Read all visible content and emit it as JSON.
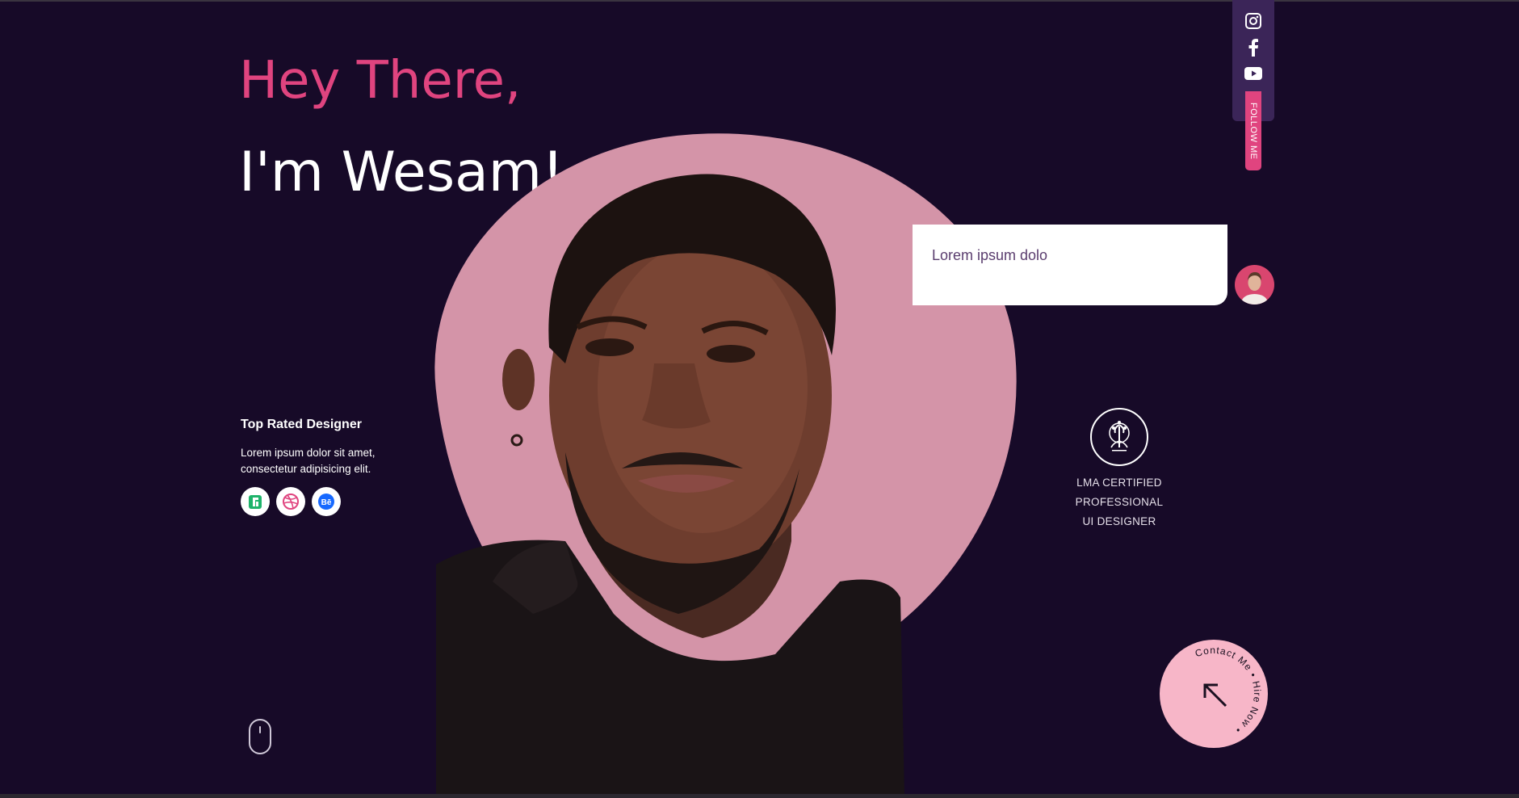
{
  "hero": {
    "greeting": "Hey There,",
    "name": "I'm Wesam!"
  },
  "chat": {
    "message": "Lorem ipsum dolo"
  },
  "social": {
    "icons": [
      "instagram-icon",
      "facebook-icon",
      "youtube-icon"
    ],
    "follow_label": "FOLLOW ME"
  },
  "rated": {
    "title": "Top Rated Designer",
    "description": "Lorem ipsum dolor sit amet, consectetur adipisicing elit.",
    "badges": [
      "upwork-icon",
      "dribbble-icon",
      "behance-icon"
    ]
  },
  "certification": {
    "line1": "LMA CERTIFIED",
    "line2": "PROFESSIONAL",
    "line3": "UI DESIGNER"
  },
  "contact": {
    "circular_text": "Contact Me • Hire Now •"
  },
  "colors": {
    "background": "#170a28",
    "accent_pink": "#e0447f",
    "blob_pink": "#d494a8",
    "social_bar": "#3b2558",
    "contact_circle": "#f7b6c8"
  }
}
